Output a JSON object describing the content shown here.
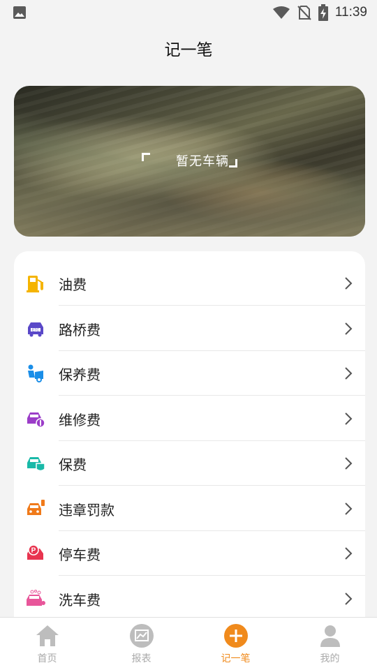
{
  "status_bar": {
    "time": "11:39",
    "icons": [
      "image-icon",
      "wifi-icon",
      "no-sim-icon",
      "battery-charging-icon"
    ]
  },
  "header": {
    "title": "记一笔"
  },
  "banner": {
    "label": "暂无车辆"
  },
  "expense_list": {
    "items": [
      {
        "label": "油费",
        "icon": "fuel-icon",
        "color": "#f5b400"
      },
      {
        "label": "路桥费",
        "icon": "etc-car-icon",
        "color": "#5a48c8"
      },
      {
        "label": "保养费",
        "icon": "maintenance-icon",
        "color": "#1a8ee8"
      },
      {
        "label": "维修费",
        "icon": "repair-car-icon",
        "color": "#9b3dc8"
      },
      {
        "label": "保费",
        "icon": "insurance-car-icon",
        "color": "#19b9a8"
      },
      {
        "label": "违章罚款",
        "icon": "violation-car-icon",
        "color": "#f07a1a"
      },
      {
        "label": "停车费",
        "icon": "parking-icon",
        "color": "#e8344f"
      },
      {
        "label": "洗车费",
        "icon": "car-wash-icon",
        "color": "#e8569a"
      }
    ]
  },
  "tabbar": {
    "tabs": [
      {
        "label": "首页",
        "icon": "home-icon",
        "active": false
      },
      {
        "label": "报表",
        "icon": "chart-icon",
        "active": false
      },
      {
        "label": "记一笔",
        "icon": "plus-circle-icon",
        "active": true
      },
      {
        "label": "我的",
        "icon": "user-icon",
        "active": false
      }
    ],
    "active_color": "#f08a1c",
    "inactive_color": "#bdbdbd"
  }
}
